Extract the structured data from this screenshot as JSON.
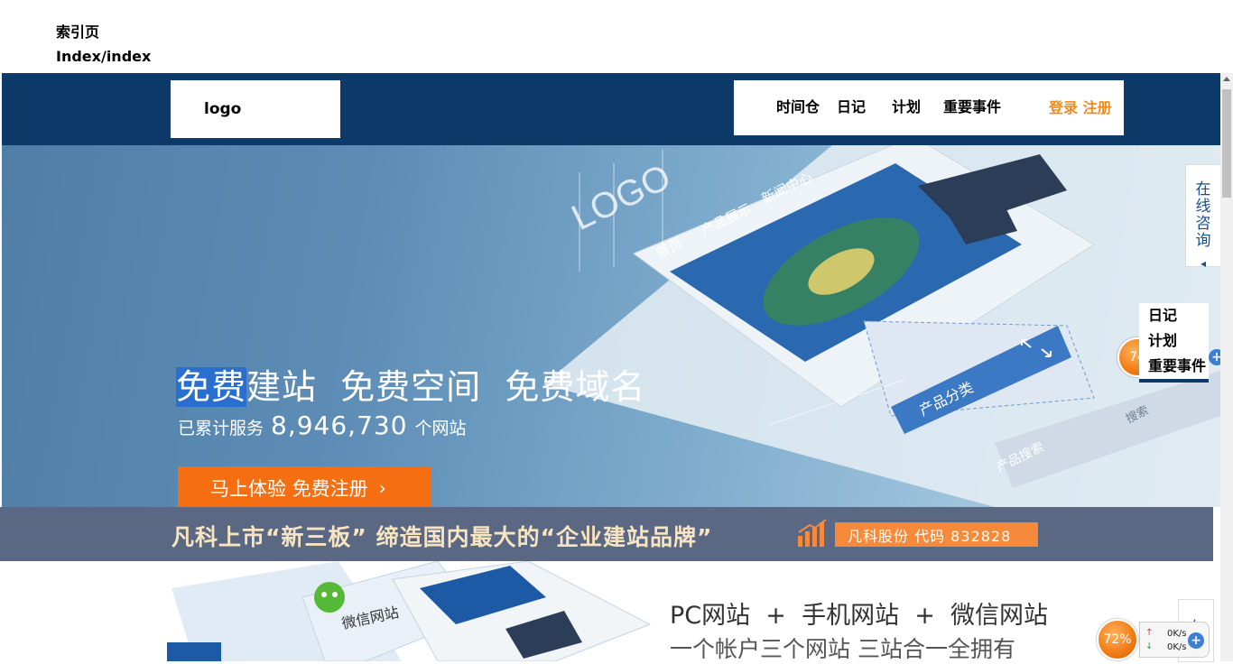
{
  "page": {
    "title_cn": "索引页",
    "title_path": "Index/index"
  },
  "header": {
    "logo": "logo",
    "nav": [
      "时间仓",
      "日记",
      "计划",
      "重要事件"
    ],
    "login": "登录",
    "register": "注册"
  },
  "hero": {
    "title_selected": "免费",
    "title_rest": "建站  免费空间  免费域名",
    "sub_prefix": "已累计服务",
    "count": "8,946,730",
    "sub_suffix": "个网站",
    "cta_label": "马上体验  免费注册",
    "cta_chevron": "›",
    "mock": {
      "logo": "LOGO",
      "tab_home": "首页",
      "tab_products": "产品展示",
      "tab_news": "新闻中心",
      "side": "产品分类",
      "search": "产品搜索",
      "search_btn": "搜索"
    }
  },
  "banner": {
    "text": "凡科上市“新三板”  缔造国内最大的“企业建站品牌”",
    "badge": "凡科股份 代码 832828"
  },
  "lower": {
    "line1": "PC网站  +  手机网站  +  微信网站",
    "line2": "一个帐户三个网站 三站合一全拥有",
    "wechat_label": "微信网站"
  },
  "sidebar": {
    "consult": [
      "在",
      "线",
      "咨",
      "询"
    ],
    "consult_arrow": "◂",
    "consult2": "在",
    "popup": [
      "日记",
      "计划",
      "重要事件"
    ]
  },
  "meter": {
    "ball_top": "74",
    "ball_bottom": "72%",
    "up": "0K/s",
    "down": "0K/s",
    "plus": "+"
  },
  "colors": {
    "topbar": "#0e3a6a",
    "accent_orange": "#f66e12",
    "login": "#f08a1c",
    "banner": "#5a6884",
    "banner_text": "#f7e4c0"
  }
}
